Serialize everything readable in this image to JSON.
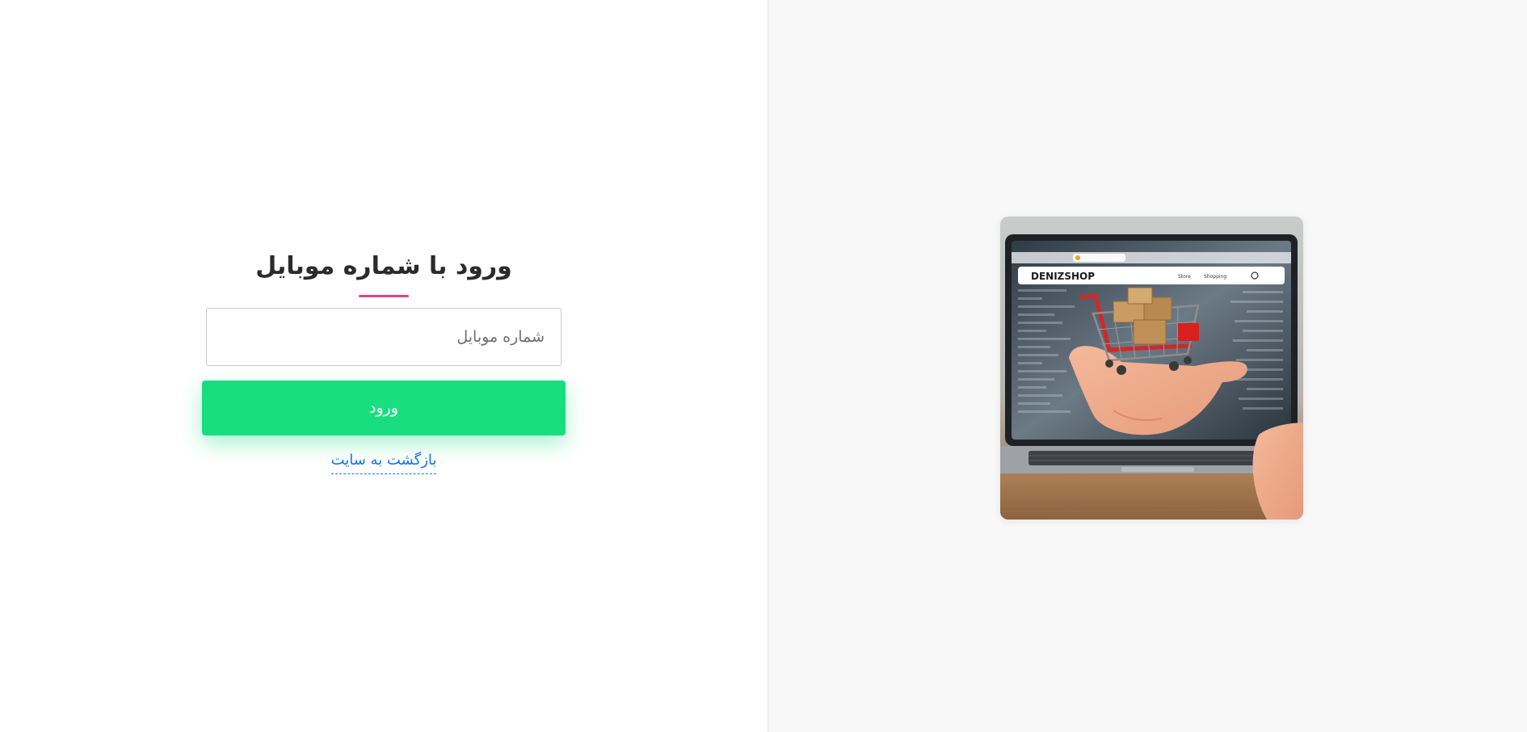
{
  "login": {
    "title": "ورود با شماره موبایل",
    "phone_placeholder": "شماره موبایل",
    "submit_label": "ورود",
    "back_link": "بازگشت به سایت"
  },
  "hero": {
    "brand_text": "DENIZSHOP",
    "nav_items": [
      "Store",
      "Shopping"
    ],
    "image_description_icon": "laptop-shopping-cart-illustration"
  },
  "colors": {
    "accent_green": "#19de7f",
    "underline_pink": "#e8417e",
    "link_blue": "#1a73e8",
    "right_bg": "#f8f8f8"
  }
}
